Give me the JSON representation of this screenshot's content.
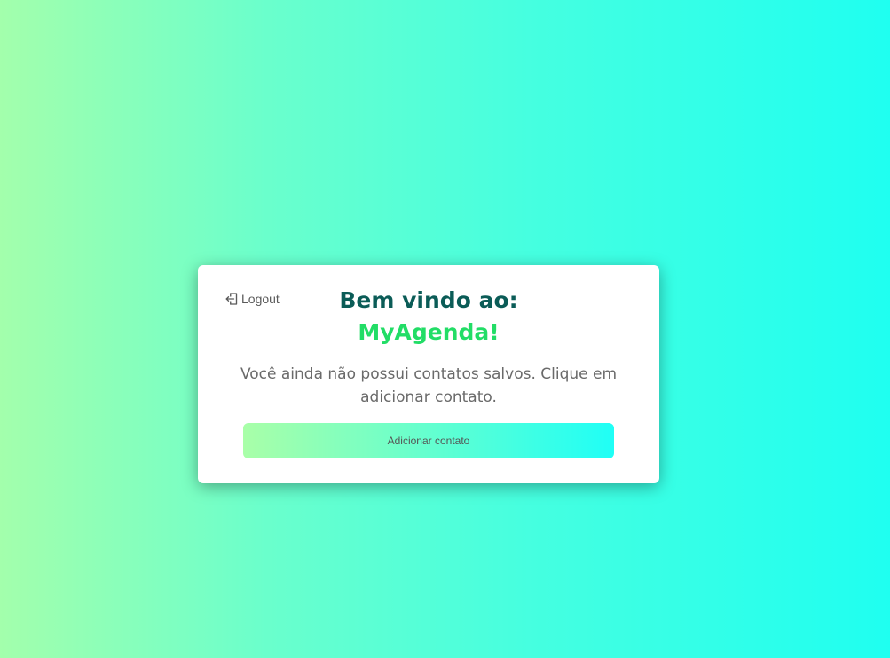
{
  "card": {
    "logout_label": "Logout",
    "title": "Bem vindo ao:",
    "brand": "MyAgenda!",
    "message": "Você ainda não possui contatos salvos. Clique em adicionar contato.",
    "add_button_label": "Adicionar contato"
  },
  "icons": {
    "logout": "logout-icon"
  },
  "colors": {
    "title": "#0b5c57",
    "brand": "#22dd66",
    "background_start": "#a3ffac",
    "background_end": "#1ffff0"
  }
}
